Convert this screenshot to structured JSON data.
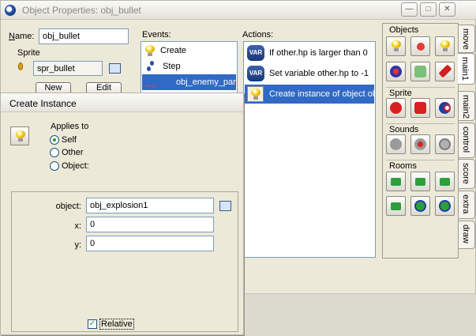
{
  "window": {
    "title": "Object Properties: obj_bullet",
    "buttons": {
      "minimize": "—",
      "maximize": "□",
      "close": "✕"
    }
  },
  "object": {
    "name_label": "Name:",
    "name_value": "obj_bullet",
    "sprite_label": "Sprite",
    "sprite_value": "spr_bullet",
    "new_label": "New",
    "edit_label": "Edit"
  },
  "events": {
    "header": "Events:",
    "items": [
      {
        "label": "Create",
        "icon": "bulb-icon"
      },
      {
        "label": "Step",
        "icon": "footsteps-icon"
      },
      {
        "label": "obj_enemy_pare",
        "icon": "collision-icon"
      }
    ]
  },
  "actions": {
    "header": "Actions:",
    "items": [
      {
        "label": "If other.hp is larger than 0",
        "icon": "VAR"
      },
      {
        "label": "Set variable other.hp to -1",
        "icon": "VAR"
      },
      {
        "label": "Create instance of object obj",
        "icon": "bulb-icon"
      }
    ]
  },
  "palette": {
    "objects_label": "Objects",
    "sprite_label": "Sprite",
    "sounds_label": "Sounds",
    "rooms_label": "Rooms"
  },
  "tabs": [
    "move",
    "main1",
    "main2",
    "control",
    "score",
    "extra",
    "draw"
  ],
  "dialog": {
    "title": "Create Instance",
    "applies_to_label": "Applies to",
    "options": [
      "Self",
      "Other",
      "Object:"
    ],
    "object_label": "object:",
    "object_value": "obj_explosion1",
    "x_label": "x:",
    "x_value": "0",
    "y_label": "y:",
    "y_value": "0",
    "relative_label": "Relative"
  },
  "colors": {
    "selection": "#316ac5",
    "accent_green": "#21a121"
  }
}
